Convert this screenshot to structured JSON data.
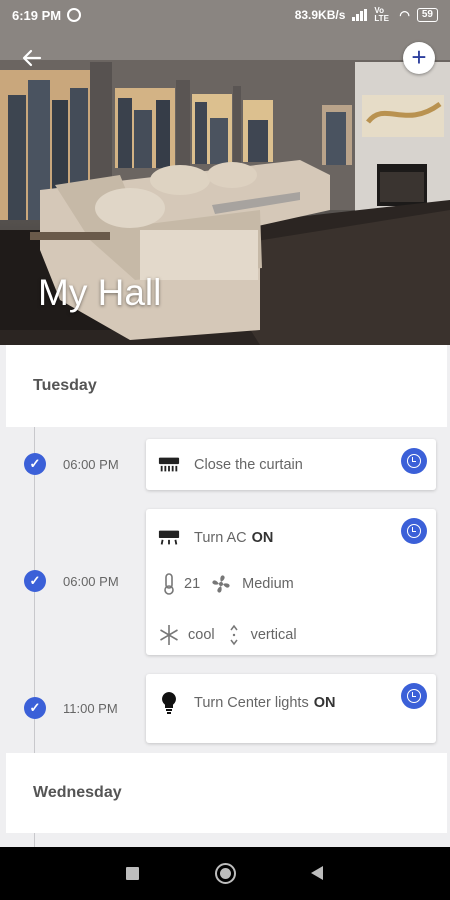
{
  "status_bar": {
    "time": "6:19 PM",
    "speed": "83.9KB/s",
    "lte": "Vo LTE",
    "battery": "59"
  },
  "header": {
    "room_name": "My Hall",
    "back_icon": "arrow-left-icon",
    "add_icon": "plus-icon"
  },
  "days": [
    {
      "label": "Tuesday",
      "events": [
        {
          "time": "06:00 PM",
          "icon": "curtain-device-icon",
          "action": "Close the curtain",
          "state": ""
        },
        {
          "time": "06:00 PM",
          "icon": "ac-device-icon",
          "action": "Turn AC",
          "state": "ON",
          "temperature": "21",
          "fan_speed": "Medium",
          "mode": "cool",
          "swing": "vertical"
        },
        {
          "time": "11:00 PM",
          "icon": "bulb-icon",
          "action": "Turn Center lights",
          "state": "ON"
        }
      ]
    },
    {
      "label": "Wednesday",
      "events": []
    }
  ],
  "colors": {
    "accent": "#3b60d8",
    "add_button_icon": "#2d3f9e",
    "background": "#efeff1"
  }
}
